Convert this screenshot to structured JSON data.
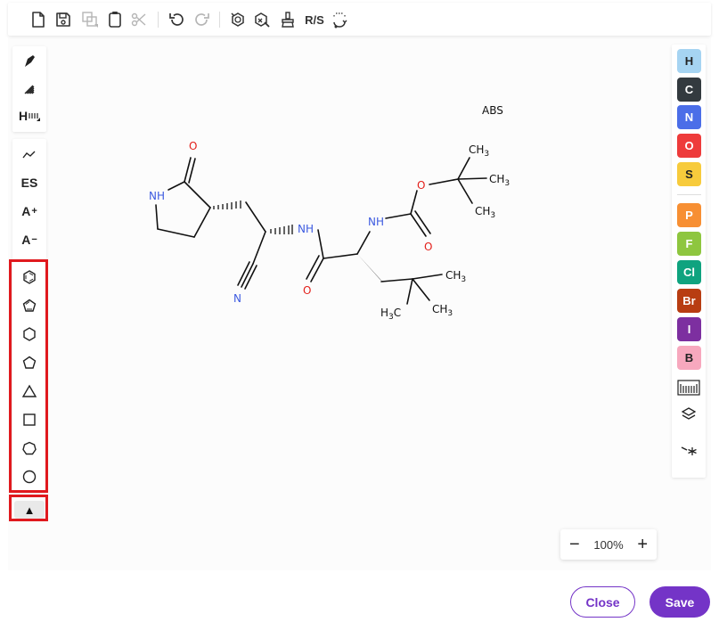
{
  "top_toolbar": {
    "rs_label": "R/S",
    "icons": [
      "new-file-icon",
      "save-icon",
      "copy-icon",
      "paste-icon",
      "cut-icon",
      "undo-icon",
      "redo-icon",
      "aromatize-icon",
      "calculate-icon",
      "clean-icon",
      "stereo-rs",
      "layout-icon"
    ]
  },
  "left_toolbar": {
    "es_label": "ES",
    "add_label": "A",
    "add_sup": "+",
    "remove_label": "A",
    "remove_sup": "−",
    "h_label": "H"
  },
  "shapes": [
    "benzene",
    "cyclopentadiene",
    "cyclohexane",
    "cyclopentane",
    "cyclopropane",
    "cyclobutane",
    "cycloheptane",
    "cyclooctane"
  ],
  "expand_glyph": "▲",
  "atoms": [
    {
      "symbol": "H",
      "color": "#a6d4f2",
      "dark": true
    },
    {
      "symbol": "C",
      "color": "#333a3f",
      "dark": false
    },
    {
      "symbol": "N",
      "color": "#4b6ee8",
      "dark": false
    },
    {
      "symbol": "O",
      "color": "#ee3b3b",
      "dark": false
    },
    {
      "symbol": "S",
      "color": "#f7cb3c",
      "dark": true
    },
    {
      "symbol": "P",
      "color": "#f78f33",
      "dark": false
    },
    {
      "symbol": "F",
      "color": "#8ec63f",
      "dark": false
    },
    {
      "symbol": "Cl",
      "color": "#0fa37f",
      "dark": false
    },
    {
      "symbol": "Br",
      "color": "#b83d12",
      "dark": false
    },
    {
      "symbol": "I",
      "color": "#7d2fa0",
      "dark": false
    },
    {
      "symbol": "B",
      "color": "#f7a8be",
      "dark": true
    }
  ],
  "molecule": {
    "abs": "ABS",
    "o_label": "O",
    "nh_label": "NH",
    "n_label": "N",
    "ch3": "CH",
    "sub3": "3",
    "h3c_h": "H",
    "h3c_c": "C"
  },
  "zoom": {
    "level": "100%",
    "minus": "−",
    "plus": "+"
  },
  "buttons": {
    "close": "Close",
    "save": "Save"
  },
  "colors": {
    "accent": "#7434c7",
    "nitrogen": "#3d5be0",
    "oxygen": "#e3201b",
    "highlight": "#e0191e"
  }
}
